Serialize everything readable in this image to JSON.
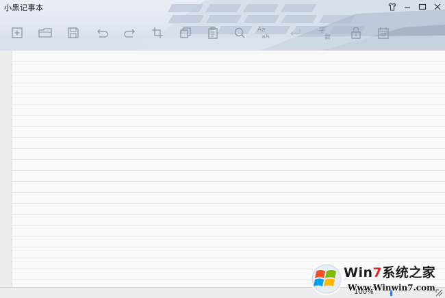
{
  "app": {
    "title": "小黑记事本"
  },
  "window_controls": [
    {
      "name": "skin-button",
      "icon": "shirt-icon"
    },
    {
      "name": "minimize-button",
      "icon": "minimize-icon"
    },
    {
      "name": "maximize-button",
      "icon": "maximize-icon"
    },
    {
      "name": "close-button",
      "icon": "close-icon"
    }
  ],
  "toolbar": {
    "icons": [
      "new-file-icon",
      "open-folder-icon",
      "save-icon",
      "undo-icon",
      "redo-icon",
      "crop-icon",
      "copy-icon",
      "paste-icon",
      "search-icon",
      "font-size-icon",
      "enter-icon",
      "word-count-icon",
      "lock-icon",
      "calendar-icon"
    ],
    "font_size_top": "Aa",
    "font_size_bottom": "aA",
    "word_count_top": "字",
    "word_count_bottom": "数"
  },
  "editor": {
    "content": ""
  },
  "statusbar": {
    "zoom": "100%"
  },
  "watermark": {
    "brand_prefix": "Win",
    "brand_seven": "7",
    "brand_suffix": "系统之家",
    "url": "Www.Winwin7.com"
  },
  "colors": {
    "accent": "#3b77d8",
    "icon": "#8a96a8"
  }
}
